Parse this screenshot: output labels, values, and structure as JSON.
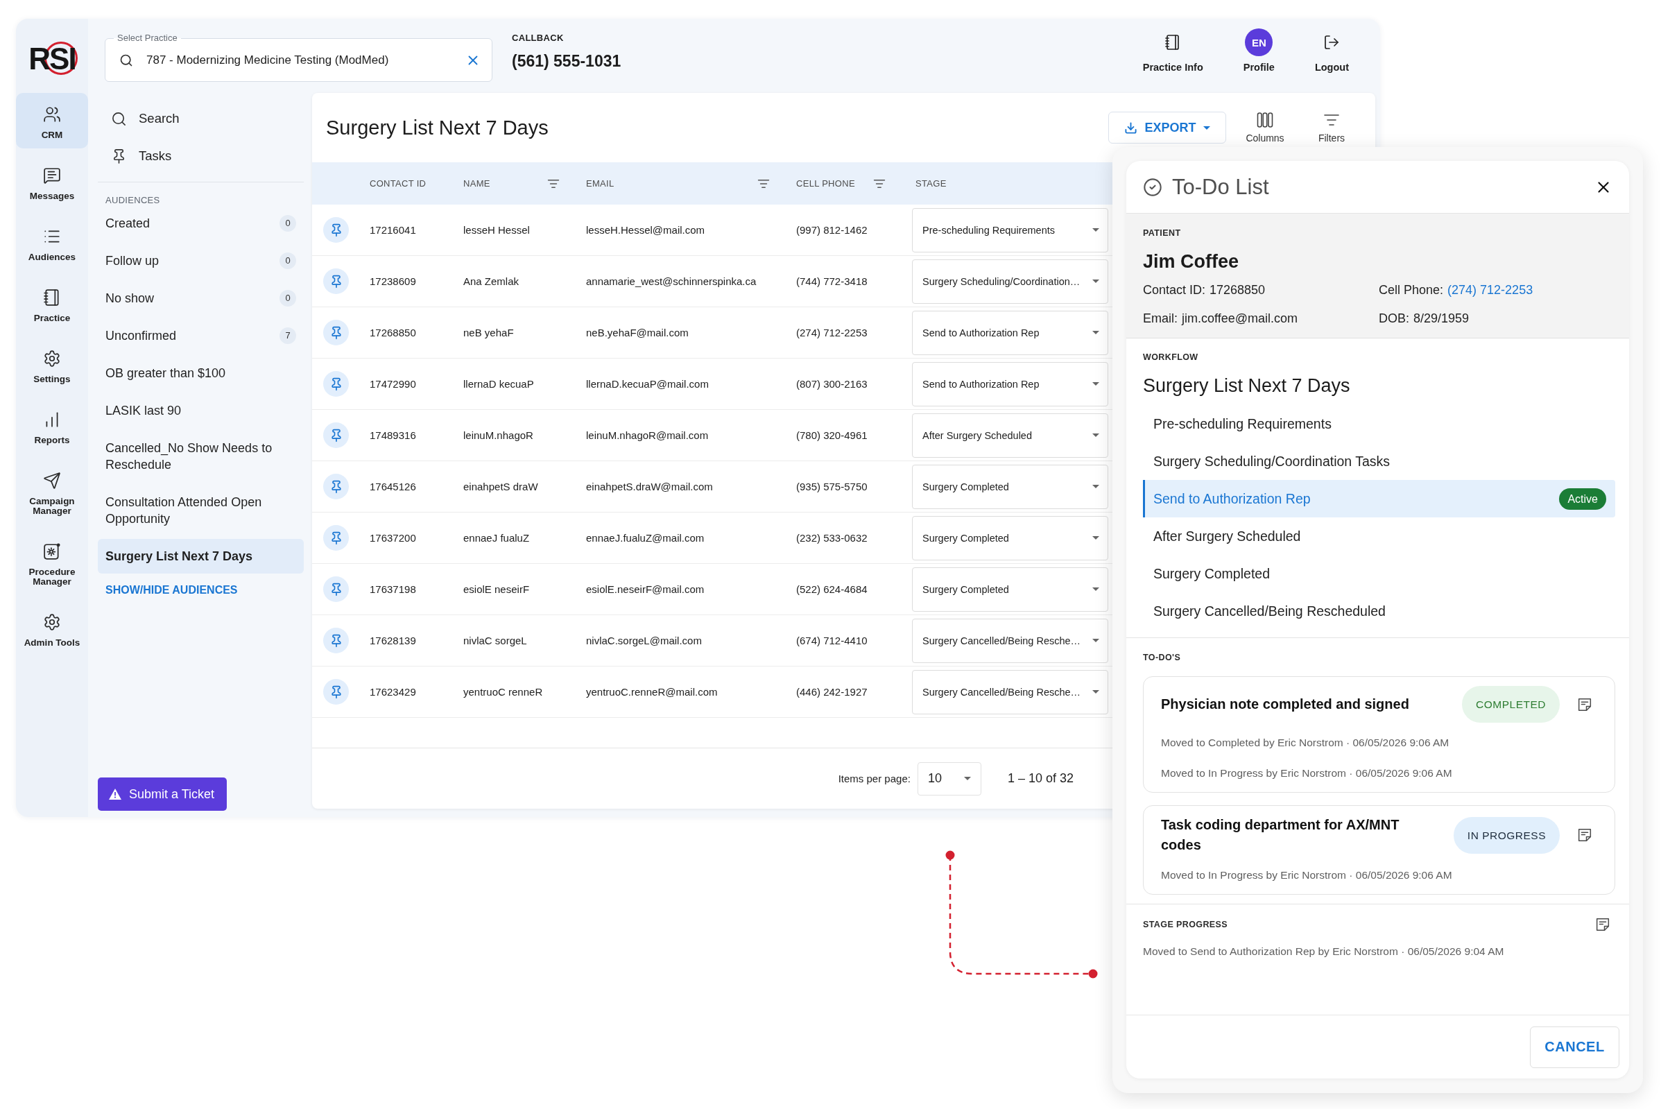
{
  "logo": "RSI",
  "nav": [
    {
      "label": "CRM",
      "selected": true
    },
    {
      "label": "Messages",
      "selected": false
    },
    {
      "label": "Audiences",
      "selected": false
    },
    {
      "label": "Practice",
      "selected": false
    },
    {
      "label": "Settings",
      "selected": false
    },
    {
      "label": "Reports",
      "selected": false
    },
    {
      "label": "Campaign Manager",
      "selected": false
    },
    {
      "label": "Procedure Manager",
      "selected": false
    },
    {
      "label": "Admin Tools",
      "selected": false
    }
  ],
  "top_bar": {
    "practice_field": {
      "label": "Select Practice",
      "value": "787 - Modernizing Medicine Testing (ModMed)"
    },
    "callback": {
      "label": "CALLBACK",
      "phone": "(561) 555-1031"
    },
    "actions": [
      {
        "kind": "icon",
        "label": "Practice Info"
      },
      {
        "kind": "avatar",
        "initials": "EN",
        "label": "Profile"
      },
      {
        "kind": "icon",
        "label": "Logout"
      }
    ]
  },
  "sidebar": {
    "links": [
      {
        "label": "Search"
      },
      {
        "label": "Tasks"
      }
    ],
    "section_label": "AUDIENCES",
    "audiences": [
      {
        "label": "Created",
        "count": "0",
        "selected": false
      },
      {
        "label": "Follow up",
        "count": "0",
        "selected": false
      },
      {
        "label": "No show",
        "count": "0",
        "selected": false
      },
      {
        "label": "Unconfirmed",
        "count": "7",
        "selected": false
      },
      {
        "label": "OB greater than $100",
        "selected": false
      },
      {
        "label": "LASIK last 90",
        "selected": false
      },
      {
        "label": "Cancelled_No Show Needs to Reschedule",
        "selected": false
      },
      {
        "label": "Consultation Attended Open Opportunity",
        "selected": false
      },
      {
        "label": "Surgery List Next 7 Days",
        "selected": true
      }
    ],
    "toggle_link": "SHOW/HIDE AUDIENCES",
    "ticket_button": "Submit a Ticket"
  },
  "list_view": {
    "title": "Surgery List Next 7 Days",
    "export_button": "EXPORT",
    "tools": [
      {
        "label": "Columns"
      },
      {
        "label": "Filters"
      }
    ],
    "columns": [
      {
        "label": "CONTACT ID",
        "filter": false
      },
      {
        "label": "NAME",
        "filter": true
      },
      {
        "label": "EMAIL",
        "filter": true
      },
      {
        "label": "CELL PHONE",
        "filter": true
      },
      {
        "label": "STAGE",
        "filter": false
      }
    ],
    "rows": [
      {
        "contact_id": "17216041",
        "name": "lesseH Hessel",
        "email": "lesseH.Hessel@mail.com",
        "cell_phone": "(997) 812-1462",
        "stage": "Pre-scheduling Requirements"
      },
      {
        "contact_id": "17238609",
        "name": "Ana Zemlak",
        "email": "annamarie_west@schinnerspinka.ca",
        "cell_phone": "(744) 772-3418",
        "stage": "Surgery Scheduling/Coordination…"
      },
      {
        "contact_id": "17268850",
        "name": "neB yehaF",
        "email": "neB.yehaF@mail.com",
        "cell_phone": "(274) 712-2253",
        "stage": "Send to Authorization Rep"
      },
      {
        "contact_id": "17472990",
        "name": "llernaD kecuaP",
        "email": "llernaD.kecuaP@mail.com",
        "cell_phone": "(807) 300-2163",
        "stage": "Send to Authorization Rep"
      },
      {
        "contact_id": "17489316",
        "name": "leinuM.nhagoR",
        "email": "leinuM.nhagoR@mail.com",
        "cell_phone": "(780) 320-4961",
        "stage": "After Surgery Scheduled"
      },
      {
        "contact_id": "17645126",
        "name": "einahpetS draW",
        "email": "einahpetS.draW@mail.com",
        "cell_phone": "(935) 575-5750",
        "stage": "Surgery Completed"
      },
      {
        "contact_id": "17637200",
        "name": "ennaeJ fualuZ",
        "email": "ennaeJ.fualuZ@mail.com",
        "cell_phone": "(232) 533-0632",
        "stage": "Surgery Completed"
      },
      {
        "contact_id": "17637198",
        "name": "esiolE neseirF",
        "email": "esiolE.neseirF@mail.com",
        "cell_phone": "(522) 624-4684",
        "stage": "Surgery Completed"
      },
      {
        "contact_id": "17628139",
        "name": "nivlaC sorgeL",
        "email": "nivlaC.sorgeL@mail.com",
        "cell_phone": "(674) 712-4410",
        "stage": "Surgery Cancelled/Being Resche…"
      },
      {
        "contact_id": "17623429",
        "name": "yentruoC renneR",
        "email": "yentruoC.renneR@mail.com",
        "cell_phone": "(446) 242-1927",
        "stage": "Surgery Cancelled/Being Resche…"
      }
    ],
    "pagination": {
      "label": "Items per page:",
      "page_size": "10",
      "range": "1 – 10 of 32"
    }
  },
  "todo_panel": {
    "title": "To-Do List",
    "patient": {
      "section_label": "PATIENT",
      "name": "Jim Coffee",
      "fields": [
        {
          "label": "Contact ID:",
          "value": "17268850",
          "kind": "text"
        },
        {
          "label": "Cell Phone:",
          "value": "(274) 712-2253",
          "kind": "link"
        },
        {
          "label": "Email:",
          "value": "jim.coffee@mail.com",
          "kind": "text"
        },
        {
          "label": "DOB:",
          "value": "8/29/1959",
          "kind": "text"
        }
      ]
    },
    "workflow": {
      "section_label": "WORKFLOW",
      "title": "Surgery List Next 7 Days",
      "steps": [
        {
          "label": "Pre-scheduling Requirements",
          "selected": false
        },
        {
          "label": "Surgery Scheduling/Coordination Tasks",
          "selected": false
        },
        {
          "label": "Send to Authorization Rep",
          "selected": true,
          "badge": "Active"
        },
        {
          "label": "After Surgery Scheduled",
          "selected": false
        },
        {
          "label": "Surgery Completed",
          "selected": false
        },
        {
          "label": "Surgery Cancelled/Being Rescheduled",
          "selected": false
        }
      ]
    },
    "todos": {
      "section_label": "TO-DO'S",
      "items": [
        {
          "title": "Physician note completed and signed",
          "status": {
            "label": "COMPLETED",
            "kind": "completed"
          },
          "history": [
            "Moved to Completed by Eric Norstrom · 06/05/2026 9:06 AM",
            "Moved to In Progress by Eric Norstrom · 06/05/2026 9:06 AM"
          ]
        },
        {
          "title": "Task coding department for AX/MNT codes",
          "status": {
            "label": "IN PROGRESS",
            "kind": "in_progress"
          },
          "history": [
            "Moved to In Progress by Eric Norstrom · 06/05/2026 9:06 AM"
          ]
        }
      ]
    },
    "stage_progress": {
      "section_label": "STAGE PROGRESS",
      "history": [
        "Moved to Send to Authorization Rep by Eric Norstrom · 06/05/2026 9:04 AM"
      ]
    },
    "cancel_button": "CANCEL"
  }
}
